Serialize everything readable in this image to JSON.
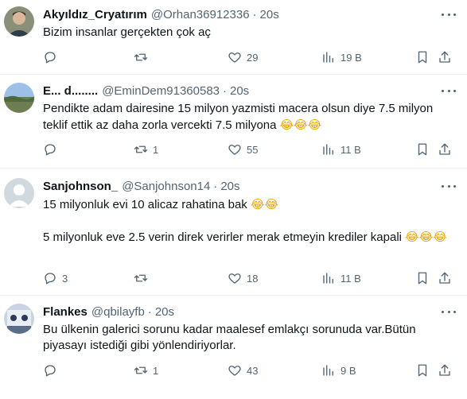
{
  "tweets": [
    {
      "name": "Akyıldız_Cryatırım",
      "handle": "@Orhan36912336",
      "time": "20s",
      "text_parts": [
        "Bizim insanlar gerçekten çok aç"
      ],
      "reply_count": "",
      "retweet_count": "",
      "like_count": "29",
      "view_count": "19 B",
      "avatar_color": "#6b7a5a"
    },
    {
      "name": "E... d........",
      "handle": "@EminDem91360583",
      "time": "20s",
      "text_parts": [
        "Pendikte adam dairesine 15 milyon yazmisti macera olsun diye 7.5 milyon teklif ettik az daha zorla vercekti 7.5 milyona ",
        "😂😂😂"
      ],
      "reply_count": "",
      "retweet_count": "1",
      "like_count": "55",
      "view_count": "11 B",
      "avatar_color": "#7fa0c8"
    },
    {
      "name": "Sanjohnson_",
      "handle": "@Sanjohnson14",
      "time": "20s",
      "text_parts": [
        "15 milyonluk evi 10 alicaz rahatina bak ",
        "😂😂",
        "5 milyonluk eve 2.5 verin direk verirler merak etmeyin krediler kapali ",
        "😂😂😂"
      ],
      "reply_count": "3",
      "retweet_count": "",
      "like_count": "18",
      "view_count": "11 B",
      "avatar_color": "#d3d6da"
    },
    {
      "name": "Flankes",
      "handle": "@qbilayfb",
      "time": "20s",
      "text_parts": [
        "Bu ülkenin galerici sorunu kadar maalesef emlakçı sorunuda var.Bütün piyasayı istediği gibi yönlendiriyorlar."
      ],
      "reply_count": "",
      "retweet_count": "1",
      "like_count": "43",
      "view_count": "9 B",
      "avatar_color": "#b8c4d6"
    }
  ]
}
